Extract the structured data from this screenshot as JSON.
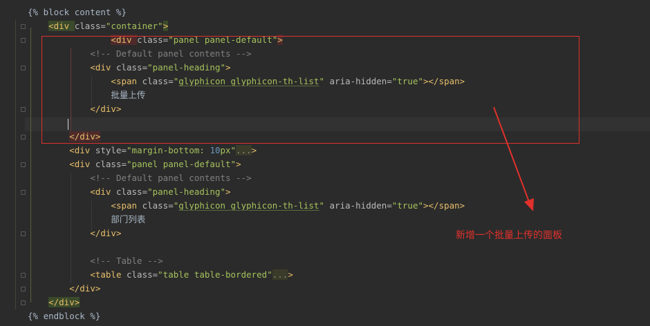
{
  "editor": {
    "lines": [
      {
        "indent": "",
        "segments": [
          {
            "cls": "tpl",
            "text": "{% block content %}"
          }
        ]
      },
      {
        "indent": "    ",
        "segments": [
          {
            "cls": "tag tag-hl",
            "text": "<div "
          },
          {
            "cls": "attr",
            "text": "class="
          },
          {
            "cls": "str",
            "text": "\"container\""
          },
          {
            "cls": "tag tag-hl",
            "text": ">"
          }
        ]
      },
      {
        "indent": "                ",
        "segments": [
          {
            "cls": "tag tag-hl-red",
            "text": "<div "
          },
          {
            "cls": "attr",
            "text": "class="
          },
          {
            "cls": "str",
            "text": "\"panel panel-default\""
          },
          {
            "cls": "tag tag-hl-red",
            "text": ">"
          }
        ]
      },
      {
        "indent": "            ",
        "segments": [
          {
            "cls": "cmt",
            "text": "<!-- Default panel contents -->"
          }
        ]
      },
      {
        "indent": "            ",
        "segments": [
          {
            "cls": "tag",
            "text": "<div "
          },
          {
            "cls": "attr",
            "text": "class="
          },
          {
            "cls": "str",
            "text": "\"panel-heading\""
          },
          {
            "cls": "tag",
            "text": ">"
          }
        ]
      },
      {
        "indent": "                ",
        "segments": [
          {
            "cls": "tag",
            "text": "<span "
          },
          {
            "cls": "attr",
            "text": "class="
          },
          {
            "cls": "str",
            "text": "\""
          },
          {
            "cls": "str squig",
            "text": "glyphicon glyphicon-th-list"
          },
          {
            "cls": "str",
            "text": "\" "
          },
          {
            "cls": "attr",
            "text": "aria-hidden="
          },
          {
            "cls": "str",
            "text": "\"true\""
          },
          {
            "cls": "tag",
            "text": "></span>"
          }
        ]
      },
      {
        "indent": "                ",
        "segments": [
          {
            "cls": "txt",
            "text": "批量上传"
          }
        ]
      },
      {
        "indent": "            ",
        "segments": [
          {
            "cls": "tag",
            "text": "</div>"
          }
        ]
      },
      {
        "indent": "",
        "segments": []
      },
      {
        "indent": "        ",
        "segments": [
          {
            "cls": "tag tag-hl-red",
            "text": "</div>"
          }
        ]
      },
      {
        "indent": "        ",
        "segments": [
          {
            "cls": "tag",
            "text": "<div "
          },
          {
            "cls": "attr",
            "text": "style="
          },
          {
            "cls": "str",
            "text": "\"margin-bottom: "
          },
          {
            "cls": "num",
            "text": "10"
          },
          {
            "cls": "str",
            "text": "px\""
          },
          {
            "cls": "fold-text",
            "text": "..."
          },
          {
            "cls": "tag",
            "text": ">"
          }
        ]
      },
      {
        "indent": "        ",
        "segments": [
          {
            "cls": "tag",
            "text": "<div "
          },
          {
            "cls": "attr",
            "text": "class="
          },
          {
            "cls": "str",
            "text": "\"panel panel-default\""
          },
          {
            "cls": "tag",
            "text": ">"
          }
        ]
      },
      {
        "indent": "            ",
        "segments": [
          {
            "cls": "cmt",
            "text": "<!-- Default panel contents -->"
          }
        ]
      },
      {
        "indent": "            ",
        "segments": [
          {
            "cls": "tag",
            "text": "<div "
          },
          {
            "cls": "attr",
            "text": "class="
          },
          {
            "cls": "str",
            "text": "\"panel-heading\""
          },
          {
            "cls": "tag",
            "text": ">"
          }
        ]
      },
      {
        "indent": "                ",
        "segments": [
          {
            "cls": "tag",
            "text": "<span "
          },
          {
            "cls": "attr",
            "text": "class="
          },
          {
            "cls": "str",
            "text": "\""
          },
          {
            "cls": "str squig",
            "text": "glyphicon glyphicon-th-list"
          },
          {
            "cls": "str",
            "text": "\" "
          },
          {
            "cls": "attr",
            "text": "aria-hidden="
          },
          {
            "cls": "str",
            "text": "\"true\""
          },
          {
            "cls": "tag",
            "text": "></span>"
          }
        ]
      },
      {
        "indent": "                ",
        "segments": [
          {
            "cls": "txt",
            "text": "部门列表"
          }
        ]
      },
      {
        "indent": "            ",
        "segments": [
          {
            "cls": "tag",
            "text": "</div>"
          }
        ]
      },
      {
        "indent": "",
        "segments": []
      },
      {
        "indent": "            ",
        "segments": [
          {
            "cls": "cmt",
            "text": "<!-- Table -->"
          }
        ]
      },
      {
        "indent": "            ",
        "segments": [
          {
            "cls": "tag",
            "text": "<table "
          },
          {
            "cls": "attr",
            "text": "class="
          },
          {
            "cls": "str",
            "text": "\"table table-bordered\""
          },
          {
            "cls": "fold-text",
            "text": "..."
          },
          {
            "cls": "tag",
            "text": ">"
          }
        ]
      },
      {
        "indent": "        ",
        "segments": [
          {
            "cls": "tag",
            "text": "</div>"
          }
        ]
      },
      {
        "indent": "    ",
        "segments": [
          {
            "cls": "tag tag-hl",
            "text": "</div>"
          }
        ]
      },
      {
        "indent": "",
        "segments": [
          {
            "cls": "tpl",
            "text": "{% endblock %}"
          }
        ]
      }
    ]
  },
  "annotation": {
    "text": "新增一个批量上传的面板",
    "color": "#e0312c"
  }
}
